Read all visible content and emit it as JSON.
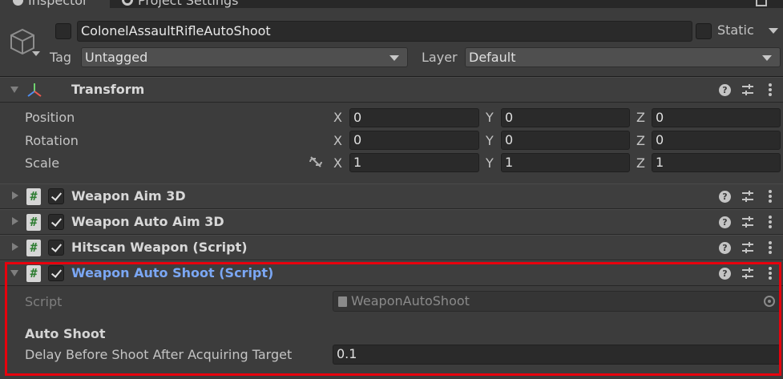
{
  "tabs": {
    "inspector": "Inspector",
    "project_settings": "Project Settings"
  },
  "header": {
    "object_name": "ColonelAssaultRifleAutoShoot",
    "static_label": "Static",
    "tag_label": "Tag",
    "tag_value": "Untagged",
    "layer_label": "Layer",
    "layer_value": "Default"
  },
  "transform": {
    "title": "Transform",
    "rows": [
      {
        "label": "Position",
        "x": "0",
        "y": "0",
        "z": "0"
      },
      {
        "label": "Rotation",
        "x": "0",
        "y": "0",
        "z": "0"
      },
      {
        "label": "Scale",
        "x": "1",
        "y": "1",
        "z": "1"
      }
    ],
    "axis_x": "X",
    "axis_y": "Y",
    "axis_z": "Z"
  },
  "components": [
    {
      "title": "Weapon Aim 3D"
    },
    {
      "title": "Weapon Auto Aim 3D"
    },
    {
      "title": "Hitscan Weapon (Script)"
    },
    {
      "title": "Weapon Auto Shoot (Script)"
    }
  ],
  "auto_shoot": {
    "script_label": "Script",
    "script_value": "WeaponAutoShoot",
    "section_header": "Auto Shoot",
    "delay_label": "Delay Before Shoot After Acquiring Target",
    "delay_value": "0.1"
  },
  "icons": {
    "hash": "#",
    "help": "?"
  },
  "colors": {
    "highlight_border": "#e8000d",
    "selected_title": "#7ba7f4"
  }
}
